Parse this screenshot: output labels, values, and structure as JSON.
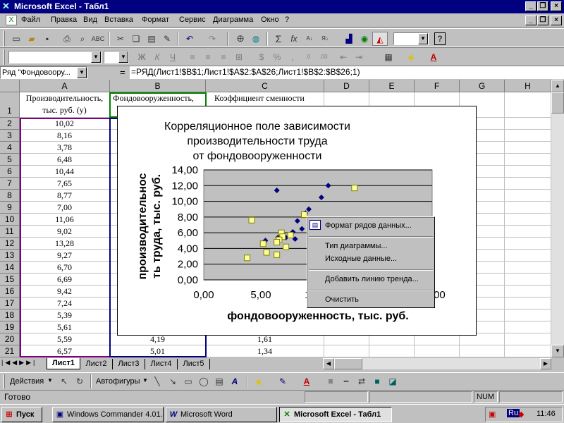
{
  "window": {
    "title": "Microsoft Excel - Табл1"
  },
  "menu": [
    "Файл",
    "Правка",
    "Вид",
    "Вставка",
    "Формат",
    "Сервис",
    "Диаграмма",
    "Окно",
    "?"
  ],
  "formula": {
    "name_box": "Ряд \"Фондовоору...",
    "eq": "=",
    "text": "=РЯД(Лист1!$B$1;Лист1!$A$2:$A$26;Лист1!$B$2:$B$26;1)"
  },
  "columns": [
    "A",
    "B",
    "C",
    "D",
    "E",
    "F",
    "G",
    "H"
  ],
  "header_row": {
    "a": "Производительность, тыс. руб. (у)",
    "b": "Фондовооруженность,",
    "c": "Коэффициент сменности"
  },
  "rows": [
    {
      "n": "1"
    },
    {
      "n": "2",
      "a": "10,02",
      "b": "",
      "c": ""
    },
    {
      "n": "3",
      "a": "8,16",
      "b": "",
      "c": ""
    },
    {
      "n": "4",
      "a": "3,78",
      "b": "",
      "c": ""
    },
    {
      "n": "5",
      "a": "6,48",
      "b": "",
      "c": ""
    },
    {
      "n": "6",
      "a": "10,44",
      "b": "",
      "c": ""
    },
    {
      "n": "7",
      "a": "7,65",
      "b": "",
      "c": ""
    },
    {
      "n": "8",
      "a": "8,77",
      "b": "",
      "c": ""
    },
    {
      "n": "9",
      "a": "7,00",
      "b": "",
      "c": ""
    },
    {
      "n": "10",
      "a": "11,06",
      "b": "",
      "c": ""
    },
    {
      "n": "11",
      "a": "9,02",
      "b": "",
      "c": ""
    },
    {
      "n": "12",
      "a": "13,28",
      "b": "",
      "c": ""
    },
    {
      "n": "13",
      "a": "9,27",
      "b": "",
      "c": ""
    },
    {
      "n": "14",
      "a": "6,70",
      "b": "",
      "c": ""
    },
    {
      "n": "15",
      "a": "6,69",
      "b": "",
      "c": ""
    },
    {
      "n": "16",
      "a": "9,42",
      "b": "",
      "c": ""
    },
    {
      "n": "17",
      "a": "7,24",
      "b": "",
      "c": ""
    },
    {
      "n": "18",
      "a": "5,39",
      "b": "",
      "c": ""
    },
    {
      "n": "19",
      "a": "5,61",
      "b": "",
      "c": ""
    },
    {
      "n": "20",
      "a": "5,59",
      "b": "4,19",
      "c": "1,61"
    },
    {
      "n": "21",
      "a": "6,57",
      "b": "5,01",
      "c": "1,34"
    }
  ],
  "chart": {
    "title": "Корреляционное поле зависимости производительности труда от фондовооруженности",
    "ylabel": "производительнос ть труда, тыс. руб.",
    "xlabel": "фондовооруженность, тыс.  руб."
  },
  "chart_data": {
    "type": "scatter",
    "title": "Корреляционное поле зависимости производительности труда от фондовооруженности",
    "xlabel": "фондовооруженность, тыс.  руб.",
    "ylabel": "производительнос ть труда, тыс. руб.",
    "ylim": [
      0,
      14
    ],
    "y_ticks": [
      "0,00",
      "2,00",
      "4,00",
      "6,00",
      "8,00",
      "10,00",
      "12,00",
      "14,00"
    ],
    "x_ticks": [
      "0,00",
      "5,00",
      "10,00",
      "15,00",
      "20,00"
    ],
    "xlim": [
      0,
      20
    ],
    "series": [
      {
        "marker": "diamond",
        "color": "#000080",
        "points": [
          [
            6.4,
            11.4
          ],
          [
            10.9,
            12.0
          ],
          [
            10.3,
            10.5
          ],
          [
            9.2,
            9.0
          ],
          [
            8.9,
            8.5
          ],
          [
            8.2,
            7.5
          ],
          [
            8.6,
            6.5
          ],
          [
            7.8,
            6.1
          ],
          [
            7.2,
            5.4
          ],
          [
            5.4,
            5.0
          ],
          [
            8.0,
            5.2
          ],
          [
            9.8,
            6.9
          ],
          [
            6.5,
            5.4
          ]
        ]
      },
      {
        "marker": "square",
        "color": "#ffff99",
        "points": [
          [
            13.2,
            11.7
          ],
          [
            4.2,
            7.6
          ],
          [
            8.8,
            8.3
          ],
          [
            6.8,
            6.0
          ],
          [
            7.6,
            5.7
          ],
          [
            6.9,
            5.5
          ],
          [
            6.6,
            5.1
          ],
          [
            6.4,
            4.8
          ],
          [
            5.2,
            4.6
          ],
          [
            7.2,
            4.2
          ],
          [
            5.5,
            3.5
          ],
          [
            6.4,
            3.2
          ],
          [
            3.8,
            2.8
          ]
        ]
      }
    ],
    "grid": true,
    "legend": "none"
  },
  "context_menu": [
    "Формат рядов данных...",
    "Тип диаграммы...",
    "Исходные данные...",
    "Добавить линию тренда...",
    "Очистить"
  ],
  "sheets": [
    "Лист1",
    "Лист2",
    "Лист3",
    "Лист4",
    "Лист5"
  ],
  "drawbar": {
    "actions": "Действия",
    "autoshapes": "Автофигуры"
  },
  "status": {
    "text": "Готово",
    "num": "NUM"
  },
  "taskbar": {
    "start": "Пуск",
    "tasks": [
      "Windows Commander 4.01...",
      "Microsoft Word",
      "Microsoft Excel - Табл1"
    ],
    "lang": "Ru",
    "time": "11:46"
  },
  "icons": [
    "excel-logo-icon",
    "new-icon",
    "open-icon",
    "save-icon",
    "print-icon",
    "preview-icon",
    "spell-icon",
    "cut-icon",
    "copy-icon",
    "paste-icon",
    "format-painter-icon",
    "undo-icon",
    "redo-icon",
    "hyperlink-icon",
    "web-icon",
    "autosum-icon",
    "function-icon",
    "sort-asc-icon",
    "sort-desc-icon",
    "chart-wizard-icon",
    "map-icon",
    "drawing-icon",
    "help-icon"
  ]
}
